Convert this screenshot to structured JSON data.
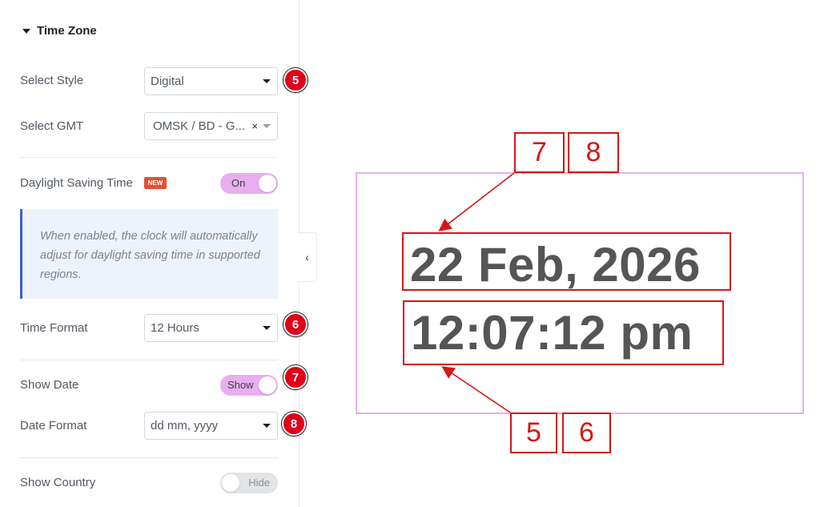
{
  "panel": {
    "section_title": "Time Zone",
    "select_style": {
      "label": "Select Style",
      "value": "Digital",
      "step": "5"
    },
    "select_gmt": {
      "label": "Select GMT",
      "value": "OMSK / BD - G...",
      "clear": "×"
    },
    "daylight": {
      "label": "Daylight Saving Time",
      "badge": "NEW",
      "toggle": "On",
      "state": "on"
    },
    "note": "When enabled, the clock will automatically adjust for daylight saving time in supported regions.",
    "time_format": {
      "label": "Time Format",
      "value": "12 Hours",
      "step": "6"
    },
    "show_date": {
      "label": "Show Date",
      "toggle": "Show",
      "state": "on",
      "step": "7"
    },
    "date_format": {
      "label": "Date Format",
      "value": "dd mm, yyyy",
      "step": "8"
    },
    "show_country": {
      "label": "Show Country",
      "toggle": "Hide",
      "state": "off"
    }
  },
  "collapse_icon": "chevron-left-icon",
  "preview": {
    "date": "22 Feb, 2026",
    "time": "12:07:12 pm",
    "callout_top": [
      "7",
      "8"
    ],
    "callout_bottom": [
      "5",
      "6"
    ]
  },
  "colors": {
    "accent_pink": "#e8aef0",
    "annotation_red": "#d51616",
    "step_red": "#e0001b",
    "note_border": "#3b5fcf",
    "badge": "#e84f31"
  }
}
